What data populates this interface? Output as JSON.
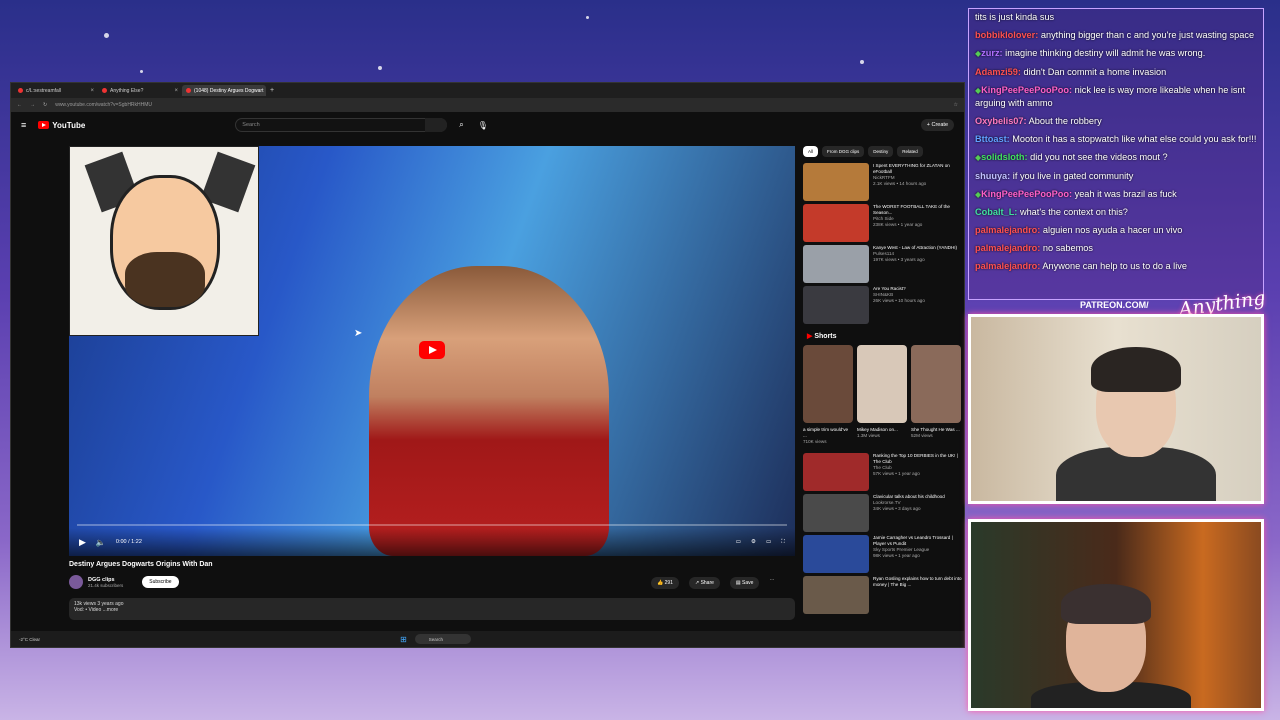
{
  "browser": {
    "tabs": [
      {
        "label": "c/L:sestreamfall"
      },
      {
        "label": "Anything Else?"
      },
      {
        "label": "(1048) Destiny Argues Dogwart"
      }
    ],
    "url": "www.youtube.com/watch?v=SgbHRkHHMU"
  },
  "youtube": {
    "logo": "YouTube",
    "search_placeholder": "Search",
    "create_label": "+ Create",
    "player_time": "0:00 / 1:22",
    "video_title": "Destiny Argues Dogwarts Origins With Dan",
    "channel_name": "DGG clips",
    "subscribers": "21.4k subscribers",
    "subscribe_label": "Subscribe",
    "likes": "291",
    "share_label": "Share",
    "save_label": "Save",
    "desc_line1": "13k views  3 years ago",
    "desc_line2": "Vod: • Video ...more"
  },
  "sidebar": {
    "chips": [
      "All",
      "From DGG clips",
      "Destiny",
      "Related"
    ],
    "recs": [
      {
        "title": "I Spent EVERYTHING for ZLATAN on eFootball",
        "channel": "NickRTFM",
        "meta": "2.1K views • 14 hours ago",
        "color": "#b57a3a"
      },
      {
        "title": "The WORST FOOTBALL TAKE of the Season...",
        "channel": "Pitch Side",
        "meta": "238K views • 1 year ago",
        "color": "#c43a2a"
      },
      {
        "title": "Kanye West - Law of Attraction (YANDHI)",
        "channel": "Pulses114",
        "meta": "197K views • 3 years ago",
        "color": "#9aa0a8"
      },
      {
        "title": "Are You Racist?",
        "channel": "SHIN&KB",
        "meta": "26K views • 10 hours ago",
        "color": "#3a3a40"
      }
    ],
    "shorts_heading": "Shorts",
    "shorts": [
      {
        "title": "a simple trim would've ...",
        "views": "710K views",
        "color": "#6a4a3a"
      },
      {
        "title": "Mikey Madison on...",
        "views": "1.3M views",
        "color": "#d8c8b8"
      },
      {
        "title": "She Thought He Was ...",
        "views": "52M views",
        "color": "#8a6a5a"
      }
    ],
    "recs2": [
      {
        "title": "Ranking the Top 10 DERBIES in the UK! | The Club",
        "channel": "The Club",
        "meta": "57K views • 1 year ago",
        "color": "#a02a2a"
      },
      {
        "title": "Clavicular talks about his childhood",
        "channel": "Lookrorse.TV",
        "meta": "34K views • 3 days ago",
        "color": "#4a4a4a"
      },
      {
        "title": "Jamie Carragher vs Leandro Trossard | Player vs Pundit",
        "channel": "Sky Sports Premier League",
        "meta": "98K views • 1 year ago",
        "color": "#2a4a9a"
      },
      {
        "title": "Ryan Gosling explains how to turn debt into money | The Big ...",
        "channel": "",
        "meta": "",
        "color": "#6a5a4a"
      }
    ]
  },
  "taskbar": {
    "weather": "-2°C Clear",
    "search": "Search"
  },
  "chat": [
    {
      "user": "",
      "color": "#fff",
      "text": "tits is just kinda sus",
      "badge": false
    },
    {
      "user": "bobbiklolover:",
      "color": "#ff5050",
      "text": "anything bigger than c and you're just wasting space",
      "badge": false
    },
    {
      "user": "zurz:",
      "color": "#b070ff",
      "text": "imagine thinking destiny will admit he was wrong.",
      "badge": true
    },
    {
      "user": "Adamzi59:",
      "color": "#ff5050",
      "text": "didn't Dan commit a home invasion",
      "badge": false
    },
    {
      "user": "KingPeePeePooPoo:",
      "color": "#ff60c8",
      "text": "nick lee is way more likeable when he isnt arguing with ammo",
      "badge": true
    },
    {
      "user": "Oxybelis07:",
      "color": "#ff7ac0",
      "text": "About the robbery",
      "badge": false
    },
    {
      "user": "Bttoast:",
      "color": "#60a0ff",
      "text": "Mooton it has a stopwatch like what else could you ask for!!!",
      "badge": false
    },
    {
      "user": "solidsloth:",
      "color": "#40e060",
      "text": "did you not see the videos mout ?",
      "badge": true
    },
    {
      "user": "shuuya:",
      "color": "#c0c0ff",
      "text": "if you live in gated community",
      "badge": false
    },
    {
      "user": "KingPeePeePooPoo:",
      "color": "#ff60c8",
      "text": "yeah it was brazil as fuck",
      "badge": true
    },
    {
      "user": "Cobalt_L:",
      "color": "#40e0a0",
      "text": "what's the context on this?",
      "badge": false
    },
    {
      "user": "palmalejandro:",
      "color": "#ff5050",
      "text": "alguien nos ayuda a hacer un vivo",
      "badge": false
    },
    {
      "user": "palmalejandro:",
      "color": "#ff5050",
      "text": "no sabemos",
      "badge": false
    },
    {
      "user": "palmalejandro:",
      "color": "#ff5050",
      "text": "Anywone can help to us to do a live",
      "badge": false
    }
  ],
  "overlay": {
    "patreon": "PATREON.COM/",
    "brand": "Anything Else?"
  }
}
